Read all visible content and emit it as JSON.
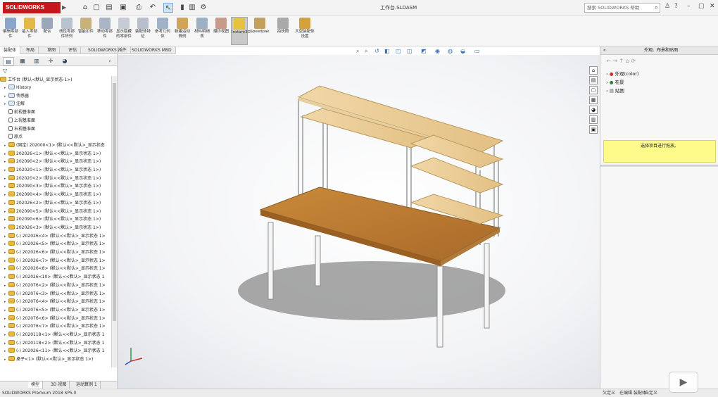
{
  "app": {
    "name": "SOLIDWORKS",
    "document_title": "工作台.SLDASM",
    "version_status": "SOLIDWORKS Premium 2018 SP5.0"
  },
  "titlebar": {
    "search_placeholder": "搜索 SOLIDWORKS 帮助"
  },
  "ribbon": {
    "buttons": [
      {
        "label": "编辑零部件",
        "color": "#8aa6c8"
      },
      {
        "label": "插入零部件",
        "color": "#e5b84a"
      },
      {
        "label": "配合",
        "color": "#9aa7b8"
      },
      {
        "label": "线性零部件阵列",
        "color": "#b9c3cf"
      },
      {
        "label": "智能扣件",
        "color": "#c9b17a"
      },
      {
        "label": "移动零部件",
        "color": "#a9b6c5"
      },
      {
        "label": "显示隐藏的零部件",
        "color": "#c7cbd2"
      },
      {
        "label": "装配体特征",
        "color": "#b7bfca"
      },
      {
        "label": "参考几何体",
        "color": "#9fb2c7"
      },
      {
        "label": "新建运动算例",
        "color": "#d2a35a"
      },
      {
        "label": "材料明细表",
        "color": "#9db0c4"
      },
      {
        "label": "爆炸视图",
        "color": "#c89a8a"
      },
      {
        "label": "Instant3D",
        "color": "#e6c23e"
      },
      {
        "label": "Speedpak",
        "color": "#c2a060"
      },
      {
        "label": "拍快照",
        "color": "#a9a9a9"
      },
      {
        "label": "大型装配体设置",
        "color": "#d4a13e"
      }
    ]
  },
  "tabs": [
    "装配体",
    "布局",
    "草图",
    "评估",
    "SOLIDWORKS 插件",
    "SOLIDWORKS MBD"
  ],
  "feature_tree": {
    "root": "工作台 (默认<默认_显示状态-1>)",
    "nodes": [
      {
        "label": "History",
        "type": "folder"
      },
      {
        "label": "传感器",
        "type": "folder"
      },
      {
        "label": "注解",
        "type": "folder"
      },
      {
        "label": "前视基准面",
        "type": "plane"
      },
      {
        "label": "上视基准面",
        "type": "plane"
      },
      {
        "label": "右视基准面",
        "type": "plane"
      },
      {
        "label": "原点",
        "type": "origin"
      },
      {
        "label": "(固定) 202000<1> (默认<<默认>_显示状态",
        "type": "part"
      },
      {
        "label": "202026<1> (默认<<默认>_显示状态 1>)",
        "type": "part"
      },
      {
        "label": "202090<2> (默认<<默认>_显示状态 1>)",
        "type": "part"
      },
      {
        "label": "202020<1> (默认<<默认>_显示状态 1>)",
        "type": "part"
      },
      {
        "label": "202020<2> (默认<<默认>_显示状态 1>)",
        "type": "part"
      },
      {
        "label": "202090<3> (默认<<默认>_显示状态 1>)",
        "type": "part"
      },
      {
        "label": "202090<4> (默认<<默认>_显示状态 1>)",
        "type": "part"
      },
      {
        "label": "202026<2> (默认<<默认>_显示状态 1>)",
        "type": "part"
      },
      {
        "label": "202090<5> (默认<<默认>_显示状态 1>)",
        "type": "part"
      },
      {
        "label": "202090<6> (默认<<默认>_显示状态 1>)",
        "type": "part"
      },
      {
        "label": "202026<3> (默认<<默认>_显示状态 1>)",
        "type": "part"
      },
      {
        "label": "(-) 202026<4> (默认<<默认>_显示状态 1>",
        "type": "part"
      },
      {
        "label": "(-) 202026<5> (默认<<默认>_显示状态 1>",
        "type": "part"
      },
      {
        "label": "(-) 202026<6> (默认<<默认>_显示状态 1>",
        "type": "part"
      },
      {
        "label": "(-) 202026<7> (默认<<默认>_显示状态 1>",
        "type": "part"
      },
      {
        "label": "(-) 202026<8> (默认<<默认>_显示状态 1>",
        "type": "part"
      },
      {
        "label": "(-) 202026<10> (默认<<默认>_显示状态 1",
        "type": "part"
      },
      {
        "label": "(-) 202076<2> (默认<<默认>_显示状态 1>",
        "type": "part"
      },
      {
        "label": "(-) 202076<3> (默认<<默认>_显示状态 1>",
        "type": "part"
      },
      {
        "label": "(-) 202076<4> (默认<<默认>_显示状态 1>",
        "type": "part"
      },
      {
        "label": "(-) 202076<5> (默认<<默认>_显示状态 1>",
        "type": "part"
      },
      {
        "label": "(-) 202076<6> (默认<<默认>_显示状态 1>",
        "type": "part"
      },
      {
        "label": "(-) 202076<7> (默认<<默认>_显示状态 1>",
        "type": "part"
      },
      {
        "label": "(-) 2020118<1> (默认<<默认>_显示状态 1",
        "type": "part"
      },
      {
        "label": "(-) 2020118<2> (默认<<默认>_显示状态 1",
        "type": "part"
      },
      {
        "label": "(-) 202026<11> (默认<<默认>_显示状态 1",
        "type": "part"
      },
      {
        "label": "桌子<1> (默认<<默认>_显示状态 1>)",
        "type": "part"
      }
    ]
  },
  "bottom_tabs": [
    "模型",
    "3D 视图",
    "运动算例 1"
  ],
  "status": {
    "left": "SOLIDWORKS Premium 2018 SP5.0",
    "right1": "欠定义",
    "right2": "在编辑 装配体",
    "right3": "自定义"
  },
  "right_panel": {
    "title": "外观、布景和贴图",
    "items": [
      "外观(color)",
      "布景",
      "贴图"
    ],
    "note": "选择项目进行拖放。"
  },
  "watermark": "▶"
}
